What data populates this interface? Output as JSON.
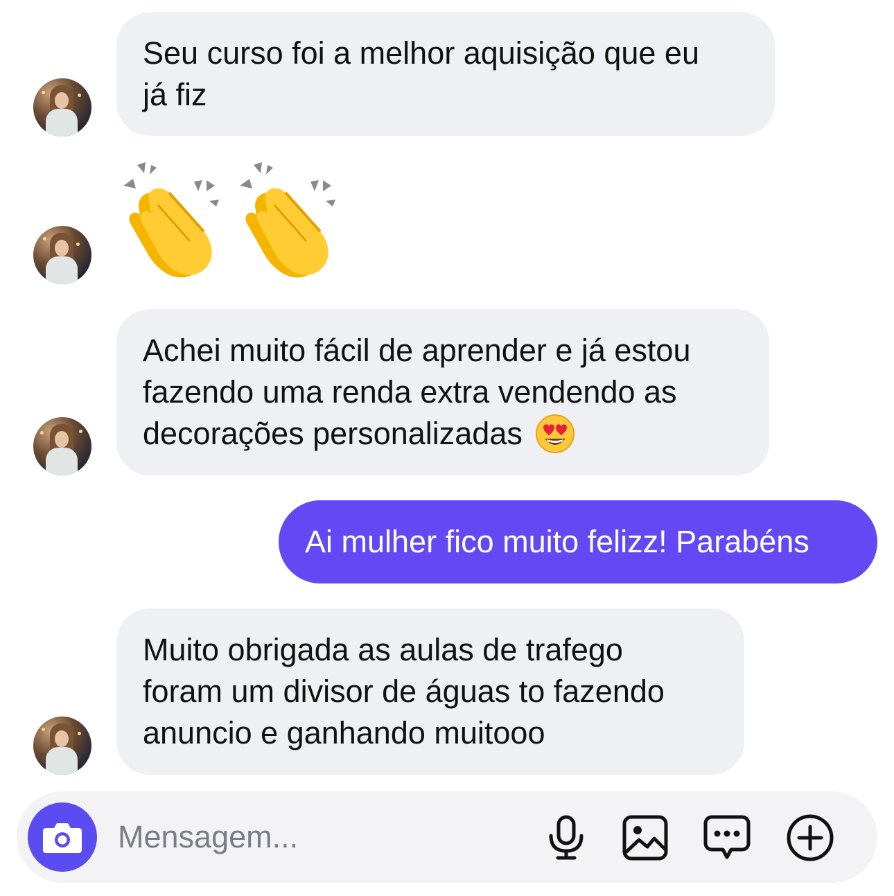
{
  "messages": [
    {
      "sender": "them",
      "text_line1": "Seu curso foi a melhor aquisição que eu",
      "text_line2": "já fiz"
    },
    {
      "sender": "them",
      "emoji": "👏👏"
    },
    {
      "sender": "them",
      "text_line1": "Achei muito fácil de aprender e já estou",
      "text_line2": "fazendo uma renda extra vendendo as",
      "text_line3": "decorações personalizadas",
      "emoji": "😍"
    },
    {
      "sender": "me",
      "text": "Ai mulher fico muito felizz! Parabéns"
    },
    {
      "sender": "them",
      "text_line1": "Muito obrigada as aulas de trafego",
      "text_line2": "foram um divisor de águas to fazendo",
      "text_line3": "anuncio e ganhando muitooo"
    }
  ],
  "composer": {
    "placeholder": "Mensagem...",
    "icons": [
      "camera-icon",
      "microphone-icon",
      "image-icon",
      "sticker-chat-icon",
      "plus-circle-icon"
    ]
  },
  "colors": {
    "incoming_bubble": "#eff0f4",
    "outgoing_bubble": "#6448f4",
    "camera_button": "#5b4cf2"
  }
}
